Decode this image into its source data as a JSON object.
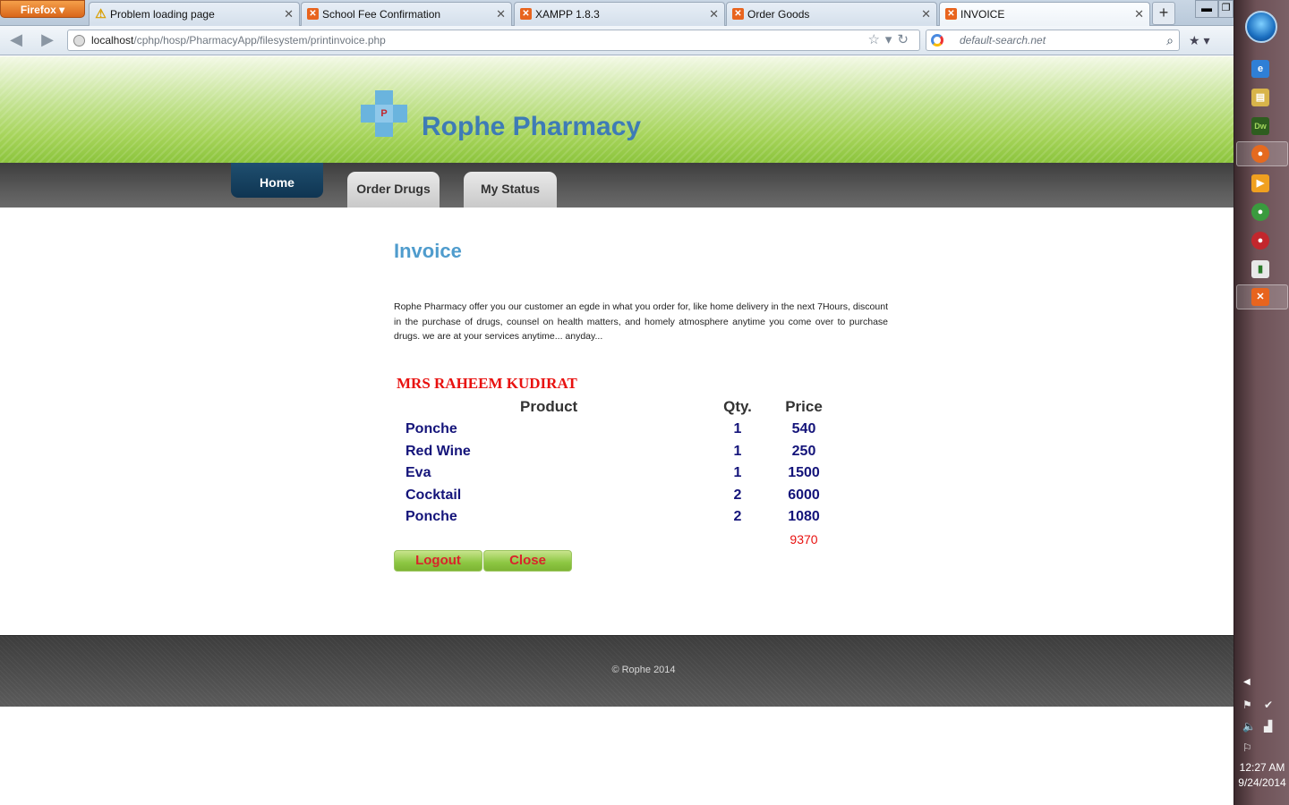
{
  "browser": {
    "menu_button": "Firefox",
    "tabs": [
      {
        "label": "Problem loading page",
        "icon": "warning-icon"
      },
      {
        "label": "School Fee Confirmation",
        "icon": "xampp-icon"
      },
      {
        "label": "XAMPP 1.8.3",
        "icon": "xampp-icon"
      },
      {
        "label": "Order Goods",
        "icon": "xampp-icon"
      },
      {
        "label": "INVOICE",
        "icon": "xampp-icon",
        "active": true
      }
    ],
    "url_host": "localhost",
    "url_path": "/cphp/hosp/PharmacyApp/filesystem/printinvoice.php",
    "search_placeholder": "default-search.net"
  },
  "site": {
    "title": "Rophe Pharmacy",
    "logo_letter": "P",
    "brand_color": "#3e7bb6",
    "menu": [
      {
        "label": "Home",
        "active": true
      },
      {
        "label": "Order Drugs"
      },
      {
        "label": "My Status"
      }
    ]
  },
  "invoice": {
    "heading": "Invoice",
    "intro": "Rophe Pharmacy offer you our customer an egde in what you order for, like home delivery in the next 7Hours, discount in the purchase of drugs, counsel on health matters, and homely atmosphere anytime you come over to purchase drugs. we are at your services anytime... anyday...",
    "customer": "MRS RAHEEM KUDIRAT",
    "headers": {
      "product": "Product",
      "qty": "Qty.",
      "price": "Price"
    },
    "items": [
      {
        "product": "Ponche",
        "qty": "1",
        "price": "540"
      },
      {
        "product": "Red Wine",
        "qty": "1",
        "price": "250"
      },
      {
        "product": "Eva",
        "qty": "1",
        "price": "1500"
      },
      {
        "product": "Cocktail",
        "qty": "2",
        "price": "6000"
      },
      {
        "product": "Ponche",
        "qty": "2",
        "price": "1080"
      }
    ],
    "total": "9370",
    "buttons": {
      "logout": "Logout",
      "close": "Close"
    }
  },
  "footer": {
    "copyright": "© Rophe 2014"
  },
  "taskbar": {
    "time": "12:27 AM",
    "date": "9/24/2014",
    "apps": [
      "internet-explorer-icon",
      "file-explorer-icon",
      "dreamweaver-icon",
      "firefox-icon",
      "media-player-icon",
      "chrome-icon",
      "app-icon",
      "chart-app-icon",
      "xampp-icon"
    ]
  }
}
